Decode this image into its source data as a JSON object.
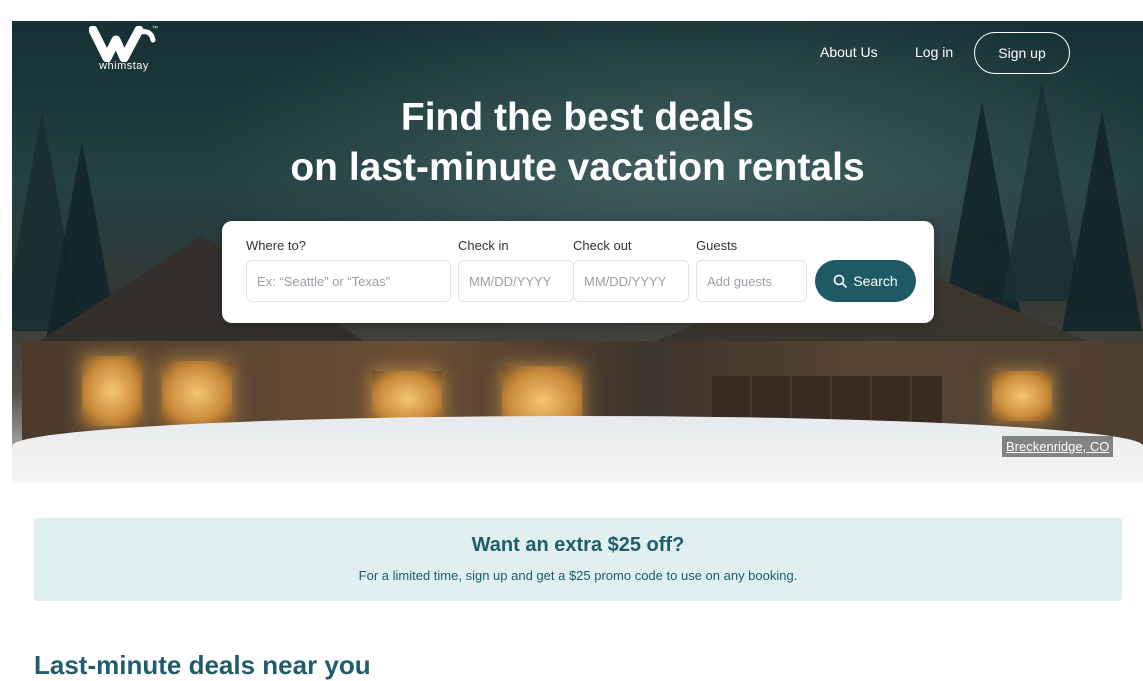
{
  "brand": {
    "logo_text": "whimstay",
    "logo_icon": "w-logo-icon",
    "tm": "™"
  },
  "nav": {
    "about_label": "About Us",
    "login_label": "Log in",
    "signup_label": "Sign up"
  },
  "hero": {
    "title_line1": "Find the best deals",
    "title_line2": "on last-minute vacation rentals",
    "photo_location": "Breckenridge, CO"
  },
  "search": {
    "where_label": "Where to?",
    "where_placeholder": "Ex: “Seattle” or “Texas”",
    "checkin_label": "Check in",
    "checkin_placeholder": "MM/DD/YYYY",
    "checkout_label": "Check out",
    "checkout_placeholder": "MM/DD/YYYY",
    "guests_label": "Guests",
    "guests_placeholder": "Add guests",
    "button_label": "Search",
    "button_icon": "search-icon"
  },
  "promo": {
    "title": "Want an extra $25 off?",
    "text": "For a limited time, sign up and get a $25 promo code to use on any booking."
  },
  "sections": {
    "deals_title": "Last-minute deals near you"
  },
  "colors": {
    "accent": "#1e5a66",
    "promo_bg": "#e0eff0",
    "promo_text": "#1f5d6a"
  }
}
